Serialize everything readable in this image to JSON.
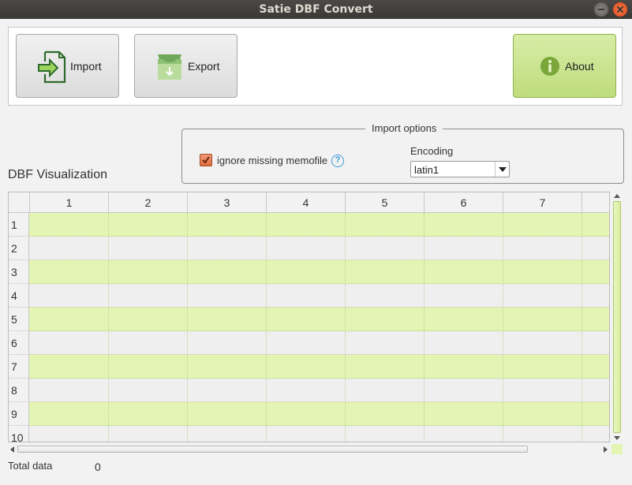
{
  "window": {
    "title": "Satie DBF Convert"
  },
  "toolbar": {
    "import_label": "Import",
    "export_label": "Export",
    "about_label": "About",
    "about_color": "#bedd7c"
  },
  "import_options": {
    "title": "Import options",
    "ignore_missing_memofile": {
      "label": "ignore missing memofile",
      "checked": true
    },
    "help_glyph": "?",
    "encoding": {
      "label": "Encoding",
      "value": "latin1"
    }
  },
  "table": {
    "title": "DBF Visualization",
    "columns": [
      "1",
      "2",
      "3",
      "4",
      "5",
      "6",
      "7"
    ],
    "rows": [
      "1",
      "2",
      "3",
      "4",
      "5",
      "6",
      "7",
      "8",
      "9",
      "10"
    ],
    "stripe_color": "#e3f4b3"
  },
  "footer": {
    "total_label": "Total data",
    "total_value": "0"
  }
}
